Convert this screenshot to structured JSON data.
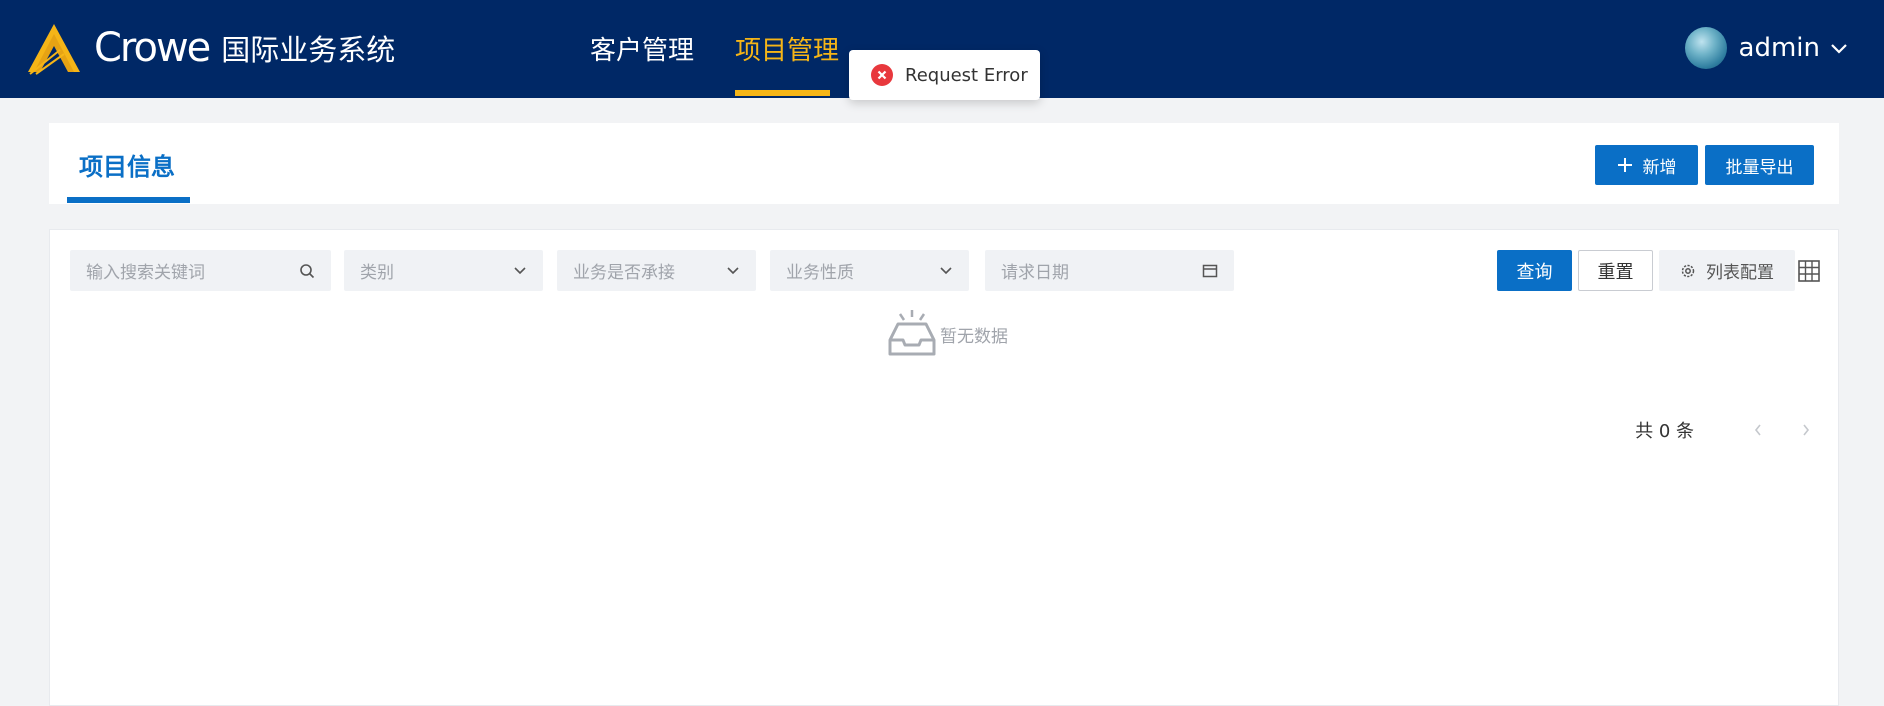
{
  "header": {
    "brand": "Crowe",
    "system_name": "国际业务系统",
    "nav": [
      {
        "label": "客户管理",
        "active": false
      },
      {
        "label": "项目管理",
        "active": true
      }
    ],
    "user": {
      "name": "admin"
    },
    "colors": {
      "background": "#002866",
      "active": "#f5b517"
    }
  },
  "toast": {
    "type": "error",
    "message": "Request Error",
    "icon": "close-circle-icon"
  },
  "page": {
    "tab": "项目信息",
    "actions": {
      "add_label": "新增",
      "export_label": "批量导出"
    }
  },
  "filters": {
    "search_placeholder": "输入搜索关键词",
    "category_placeholder": "类别",
    "undertaken_placeholder": "业务是否承接",
    "nature_placeholder": "业务性质",
    "date_placeholder": "请求日期",
    "query_label": "查询",
    "reset_label": "重置",
    "config_label": "列表配置"
  },
  "table": {
    "empty_text": "暂无数据"
  },
  "pagination": {
    "total_text": "共 0 条"
  },
  "accent_color": "#0a6fc6"
}
